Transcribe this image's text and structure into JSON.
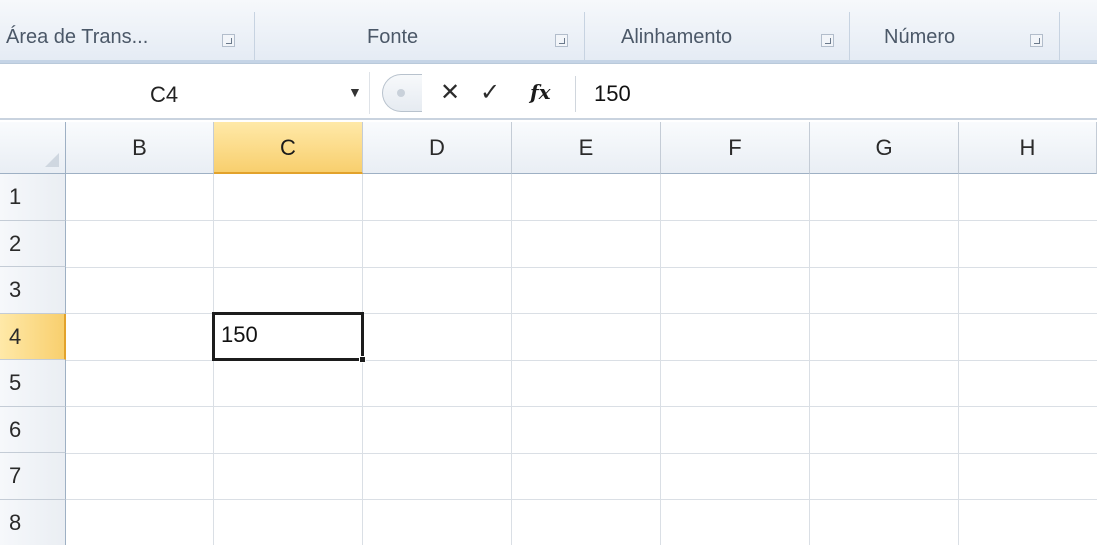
{
  "ribbon": {
    "groups": [
      {
        "label": "Área de Trans..."
      },
      {
        "label": "Fonte"
      },
      {
        "label": "Alinhamento"
      },
      {
        "label": "Número"
      }
    ]
  },
  "formula_bar": {
    "name_box": "C4",
    "cancel_glyph": "✕",
    "enter_glyph": "✓",
    "function_glyph": "fx",
    "content": "150"
  },
  "sheet": {
    "columns": [
      "B",
      "C",
      "D",
      "E",
      "F",
      "G",
      "H"
    ],
    "rows": [
      "1",
      "2",
      "3",
      "4",
      "5",
      "6",
      "7",
      "8"
    ],
    "selected_column": "C",
    "selected_row": "4",
    "active_cell_value": "150",
    "selection_color": "#f8cf6e"
  },
  "icons": [
    "dialog-launcher-icon",
    "dropdown-arrow-icon",
    "cancel-icon",
    "enter-icon",
    "insert-function-icon",
    "select-all-icon"
  ]
}
